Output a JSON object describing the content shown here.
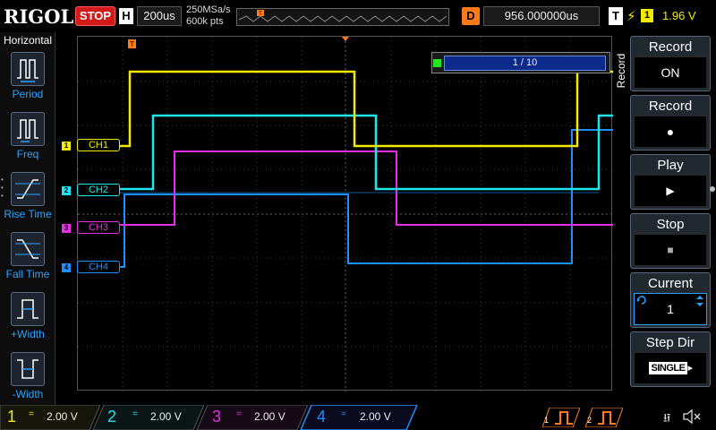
{
  "topbar": {
    "brand": "RIGOL",
    "run_state": "STOP",
    "horizontal_badge": "H",
    "timebase": "200us",
    "sample_rate": "250MSa/s",
    "memory_depth": "600k pts",
    "delay_badge": "D",
    "delay_value": "956.000000us",
    "trigger_badge": "T",
    "trigger_source": "1",
    "trigger_level": "1.96 V",
    "colors": {
      "stop": "#d21a1a",
      "delay": "#ff7a1a",
      "trigger": "#f3ea00"
    }
  },
  "left_menu": {
    "title": "Horizontal",
    "items": [
      {
        "label": "Period",
        "icon": "period-icon"
      },
      {
        "label": "Freq",
        "icon": "freq-icon"
      },
      {
        "label": "Rise Time",
        "icon": "rise-time-icon"
      },
      {
        "label": "Fall Time",
        "icon": "fall-time-icon"
      },
      {
        "label": "+Width",
        "icon": "positive-width-icon"
      },
      {
        "label": "-Width",
        "icon": "negative-width-icon"
      }
    ]
  },
  "channels": [
    {
      "tag": "CH1",
      "num": "1",
      "color": "#f3ea00"
    },
    {
      "tag": "CH2",
      "num": "2",
      "color": "#1ee6f0"
    },
    {
      "tag": "CH3",
      "num": "3",
      "color": "#e62ee6"
    },
    {
      "tag": "CH4",
      "num": "4",
      "color": "#1e8fff"
    }
  ],
  "record_counter": "1 / 10",
  "right_menu": {
    "title": "Record",
    "buttons": [
      {
        "label": "Record",
        "value": "ON"
      },
      {
        "label": "Record",
        "value": "●"
      },
      {
        "label": "Play",
        "value": "▶"
      },
      {
        "label": "Stop",
        "value": "■"
      },
      {
        "label": "Current",
        "value": "1"
      },
      {
        "label": "Step Dir",
        "value": "SINGLE"
      }
    ]
  },
  "bottom_bar": {
    "channels": [
      {
        "num": "1",
        "scale": "2.00 V",
        "color": "#f3ea00"
      },
      {
        "num": "2",
        "scale": "2.00 V",
        "color": "#1ee6f0"
      },
      {
        "num": "3",
        "scale": "2.00 V",
        "color": "#e62ee6"
      },
      {
        "num": "4",
        "scale": "2.00 V",
        "color": "#1e8fff"
      }
    ],
    "coupling": "=",
    "math_labels": [
      "1",
      "2"
    ]
  }
}
